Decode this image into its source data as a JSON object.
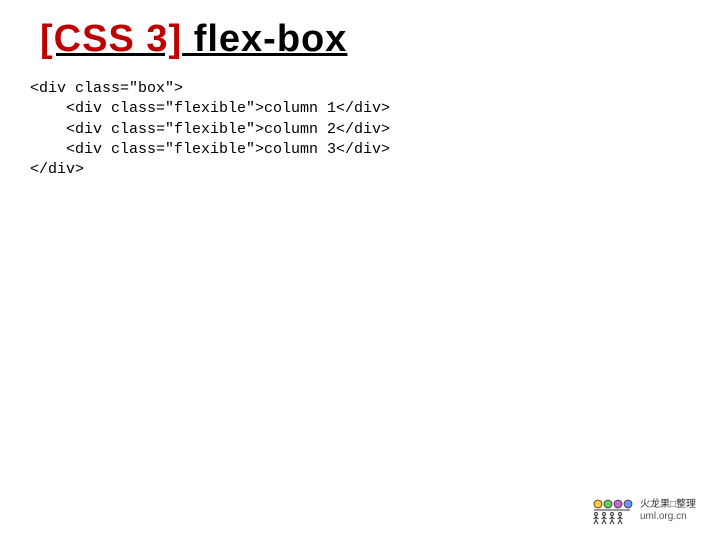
{
  "title": {
    "bracket": "[CSS 3]",
    "label": " flex-box"
  },
  "code": {
    "l1": "<div class=\"box\">",
    "l2": "    <div class=\"flexible\">column 1</div>",
    "l3": "    <div class=\"flexible\">column 2</div>",
    "l4": "    <div class=\"flexible\">column 3</div>",
    "l5": "</div>"
  },
  "footer": {
    "line1": "火龙果□整理",
    "line2": "uml.org.cn"
  }
}
